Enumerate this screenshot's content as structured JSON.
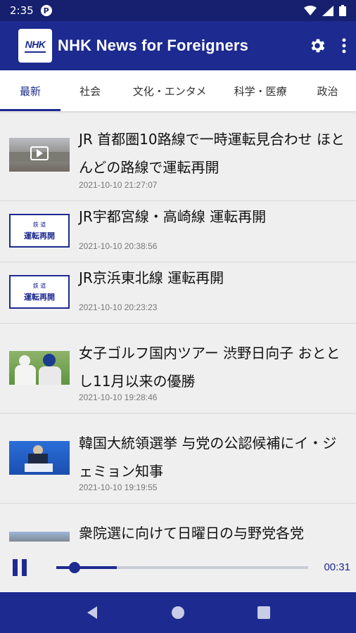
{
  "status_bar": {
    "time": "2:35",
    "notification_icon": "P"
  },
  "app_bar": {
    "title": "NHK News for Foreigners",
    "logo_text": "NHK",
    "settings_icon": "gear-icon",
    "menu_icon": "more-vert-icon"
  },
  "tabs": [
    {
      "label": "最新",
      "active": true
    },
    {
      "label": "社会",
      "active": false
    },
    {
      "label": "文化・エンタメ",
      "active": false
    },
    {
      "label": "科学・医療",
      "active": false
    },
    {
      "label": "政治",
      "active": false
    }
  ],
  "articles": [
    {
      "headline": "JR 首都圏10路線で一時運転見合わせ ほとんどの路線で運転再開",
      "date": "2021-10-10 21:27:07",
      "thumb": "video"
    },
    {
      "headline": "JR宇都宮線・高崎線 運転再開",
      "date": "2021-10-10 20:38:56",
      "thumb": "label",
      "thumb_label_1": "鉄 道",
      "thumb_label_2": "運転再開"
    },
    {
      "headline": "JR京浜東北線 運転再開",
      "date": "2021-10-10 20:23:23",
      "thumb": "label",
      "thumb_label_1": "鉄 道",
      "thumb_label_2": "運転再開"
    },
    {
      "headline": "女子ゴルフ国内ツアー 渋野日向子 おととし11月以来の優勝",
      "date": "2021-10-10 19:28:46",
      "thumb": "golf"
    },
    {
      "headline": "韓国大統領選挙 与党の公認候補にイ・ジェミョン知事",
      "date": "2021-10-10 19:19:55",
      "thumb": "podium"
    },
    {
      "headline": "衆院選に向けて日曜日の与野党各党",
      "date": "",
      "thumb": "street"
    }
  ],
  "player": {
    "elapsed": "00:31",
    "progress_fraction": 0.24,
    "buffered_fraction": 0.24
  },
  "colors": {
    "brand": "#1d2a90",
    "status_bar": "#16206f",
    "background": "#efefef"
  }
}
